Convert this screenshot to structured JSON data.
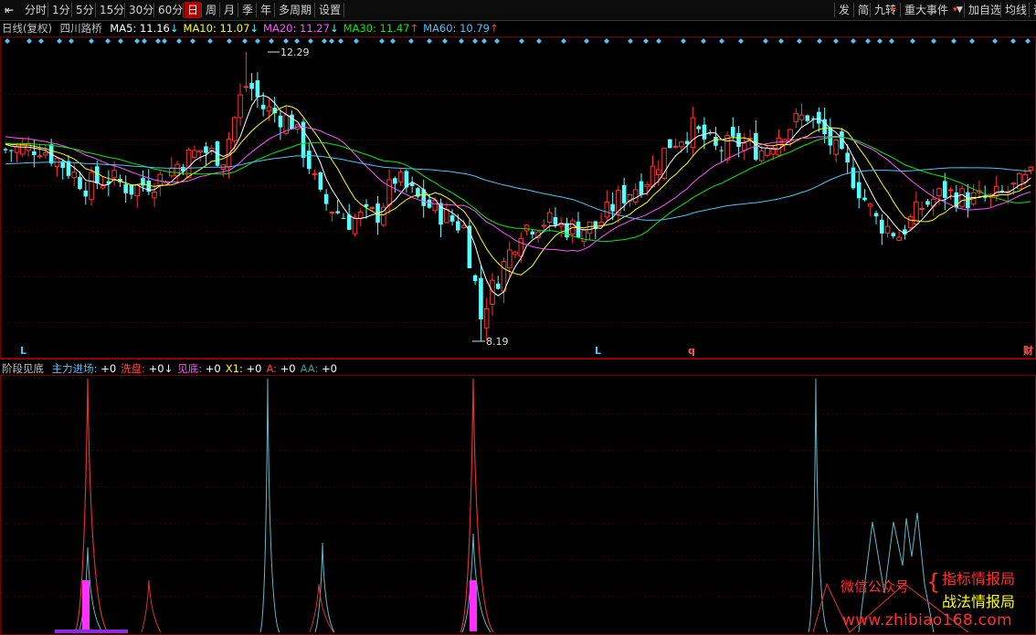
{
  "toolbar": {
    "back_icon": "back-arrow-icon",
    "periods": [
      "分时",
      "1分",
      "5分",
      "15分",
      "30分",
      "60分",
      "日",
      "周",
      "月",
      "季",
      "年",
      "多周期",
      "设置"
    ],
    "active_period": "日",
    "right_items": [
      "发",
      "简",
      "九转",
      "重大事件",
      "加自选",
      "均线",
      "资"
    ]
  },
  "main": {
    "period_label": "日线(复权)",
    "stock_name": "四川路桥",
    "ma": [
      {
        "label": "MA5: ",
        "value": "11.16",
        "arrow": "↓",
        "color": "#ffffff"
      },
      {
        "label": "MA10: ",
        "value": "11.07",
        "arrow": "↓",
        "color": "#ffff00"
      },
      {
        "label": "MA20: ",
        "value": "11.27",
        "arrow": "↓",
        "color": "#ff55ff"
      },
      {
        "label": "MA30: ",
        "value": "11.47",
        "arrow": "↑",
        "color": "#00ee00"
      },
      {
        "label": "MA60: ",
        "value": "10.79",
        "arrow": "↑",
        "color": "#4fc3f7"
      }
    ],
    "high_label": "12.29",
    "low_label": "8.19",
    "bottom_markers": [
      {
        "text": "L",
        "color": "#4fc3f7"
      },
      {
        "text": "L",
        "color": "#4fc3f7"
      },
      {
        "text": "q",
        "color": "#ff5555"
      },
      {
        "text": "财",
        "color": "#ff5555"
      }
    ]
  },
  "sub": {
    "title": "阶段见底",
    "items": [
      {
        "label": "主力进场: ",
        "value": "+0",
        "color": "#4fc3f7"
      },
      {
        "label": "洗盘: ",
        "value": "+0↓",
        "color": "#ff4040"
      },
      {
        "label": "见底: ",
        "value": "+0",
        "color": "#ff55ff"
      },
      {
        "label": "X1: ",
        "value": "+0",
        "color": "#ffff00"
      },
      {
        "label": "A: ",
        "value": "+0",
        "color": "#ff4040"
      },
      {
        "label": "AA: ",
        "value": "+0",
        "color": "#2aa198"
      }
    ]
  },
  "watermark": {
    "wechat": "微信公众号",
    "line1": "指标情报局",
    "line2": "战法情报局",
    "url": "www.zhibiao168.com"
  },
  "chart_data": {
    "type": "candlestick",
    "price_high": 12.29,
    "price_low": 8.19,
    "ma_values": {
      "MA5": 11.16,
      "MA10": 11.07,
      "MA20": 11.27,
      "MA30": 11.47,
      "MA60": 10.79
    },
    "colors": {
      "up": "#ff3232",
      "down": "#54ffff",
      "ma5": "#ffffff",
      "ma10": "#ffff00",
      "ma20": "#ff55ff",
      "ma30": "#00ee00",
      "ma60": "#4fc3f7"
    }
  }
}
